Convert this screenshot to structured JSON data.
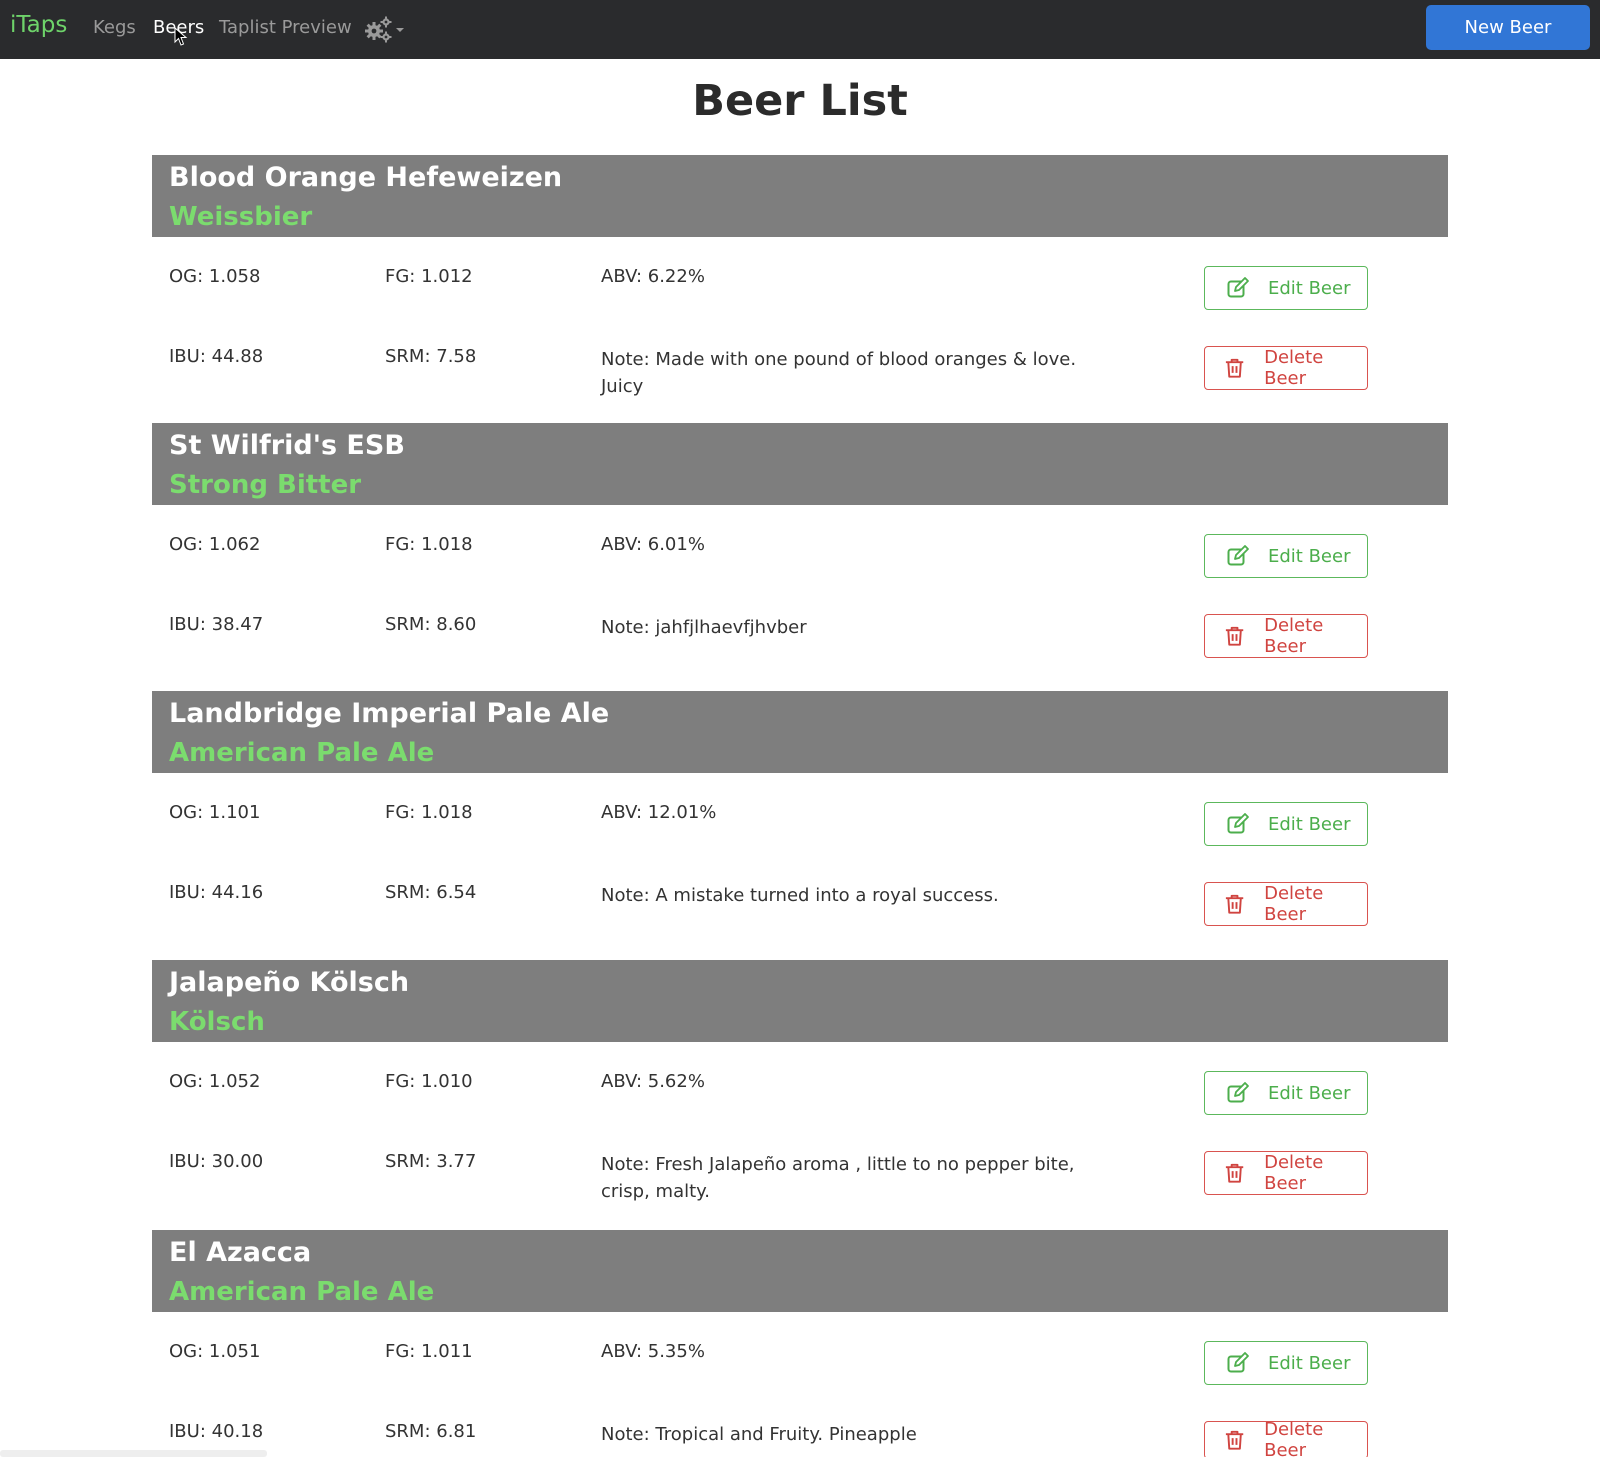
{
  "nav": {
    "brand": "iTaps",
    "links": [
      "Kegs",
      "Beers",
      "Taplist Preview"
    ],
    "new_beer_label": "New Beer"
  },
  "page_title": "Beer List",
  "buttons": {
    "edit_label": "Edit Beer",
    "delete_label": "Delete Beer"
  },
  "beers": [
    {
      "name": "Blood Orange Hefeweizen",
      "style": "Weissbier",
      "og": "OG: 1.058",
      "fg": "FG: 1.012",
      "abv": "ABV: 6.22%",
      "ibu": "IBU: 44.88",
      "srm": "SRM: 7.58",
      "note": "Note: Made with one pound of blood oranges & love. Juicy"
    },
    {
      "name": "St Wilfrid's ESB",
      "style": "Strong Bitter",
      "og": "OG: 1.062",
      "fg": "FG: 1.018",
      "abv": "ABV: 6.01%",
      "ibu": "IBU: 38.47",
      "srm": "SRM: 8.60",
      "note": "Note: jahfjlhaevfjhvber"
    },
    {
      "name": "Landbridge Imperial Pale Ale",
      "style": "American Pale Ale",
      "og": "OG: 1.101",
      "fg": "FG: 1.018",
      "abv": "ABV: 12.01%",
      "ibu": "IBU: 44.16",
      "srm": "SRM: 6.54",
      "note": "Note: A mistake turned into a royal success."
    },
    {
      "name": "Jalapeño Kölsch",
      "style": "Kölsch",
      "og": "OG: 1.052",
      "fg": "FG: 1.010",
      "abv": "ABV: 5.62%",
      "ibu": "IBU: 30.00",
      "srm": "SRM: 3.77",
      "note": "Note: Fresh Jalapeño aroma , little to no pepper bite, crisp, malty."
    },
    {
      "name": "El Azacca",
      "style": "American Pale Ale",
      "og": "OG: 1.051",
      "fg": "FG: 1.011",
      "abv": "ABV: 5.35%",
      "ibu": "IBU: 40.18",
      "srm": "SRM: 6.81",
      "note": "Note: Tropical and Fruity. Pineapple"
    }
  ],
  "colors": {
    "navbar": "#2a2b2d",
    "brand": "#6ed36a",
    "primary": "#3176d6",
    "header_bg": "#7e7e7e",
    "style_text": "#7bdc6e",
    "edit": "#5cb85c",
    "delete": "#d9534f"
  },
  "icons": {
    "settings": "gear-icon",
    "edit": "edit-icon",
    "delete": "trash-icon"
  }
}
